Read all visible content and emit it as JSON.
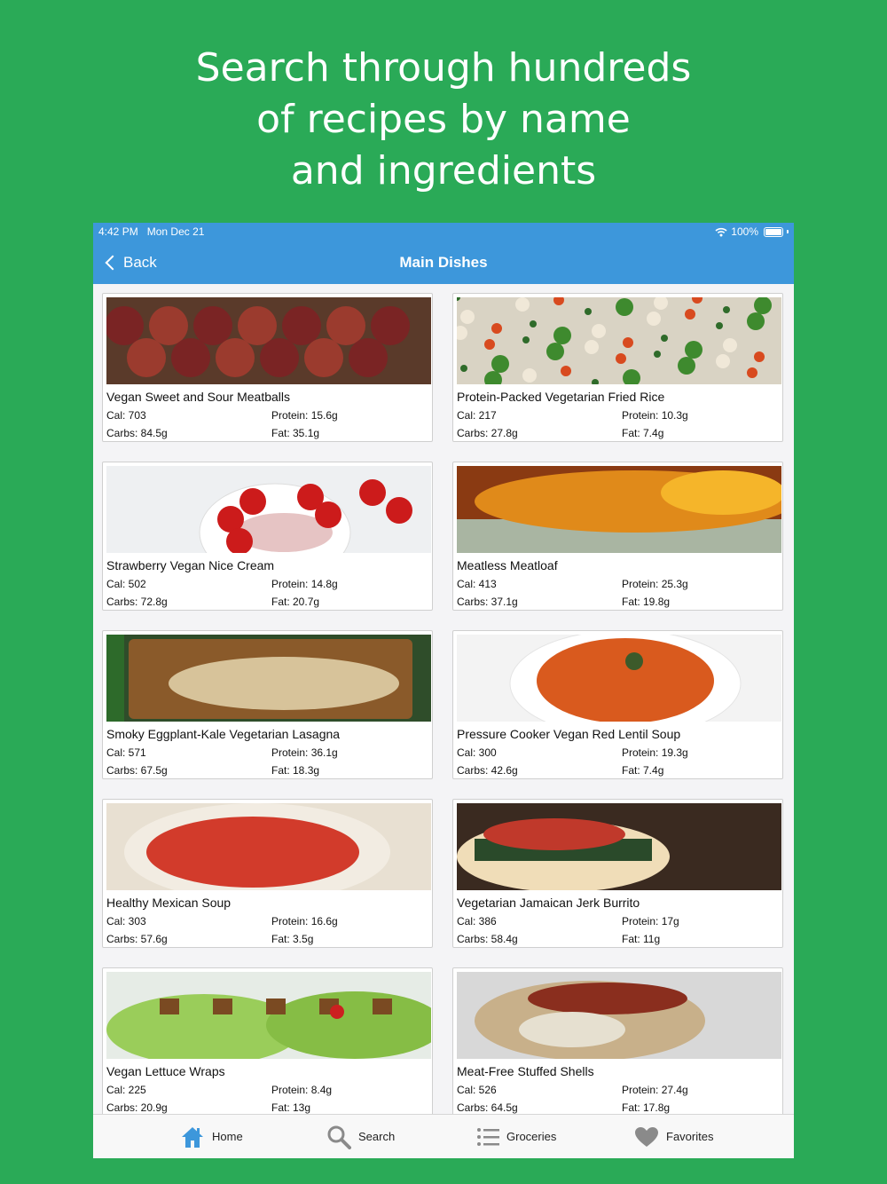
{
  "headline": {
    "lines": [
      "Search through hundreds",
      "of recipes by name",
      "and ingredients"
    ]
  },
  "status_bar": {
    "time": "4:42 PM",
    "date": "Mon Dec 21",
    "battery": "100%"
  },
  "nav": {
    "back_label": "Back",
    "title": "Main Dishes"
  },
  "recipes": [
    {
      "name": "Vegan Sweet and Sour Meatballs",
      "cal": "Cal: 703",
      "protein": "Protein: 15.6g",
      "carbs": "Carbs: 84.5g",
      "fat": "Fat: 35.1g",
      "image": "meatballs-photo"
    },
    {
      "name": "Protein-Packed Vegetarian Fried Rice",
      "cal": "Cal: 217",
      "protein": "Protein: 10.3g",
      "carbs": "Carbs: 27.8g",
      "fat": "Fat: 7.4g",
      "image": "fried-rice-photo"
    },
    {
      "name": "Strawberry Vegan Nice Cream",
      "cal": "Cal: 502",
      "protein": "Protein: 14.8g",
      "carbs": "Carbs: 72.8g",
      "fat": "Fat: 20.7g",
      "image": "nice-cream-photo"
    },
    {
      "name": "Meatless Meatloaf",
      "cal": "Cal: 413",
      "protein": "Protein: 25.3g",
      "carbs": "Carbs: 37.1g",
      "fat": "Fat: 19.8g",
      "image": "meatloaf-photo"
    },
    {
      "name": "Smoky Eggplant-Kale Vegetarian Lasagna",
      "cal": "Cal: 571",
      "protein": "Protein: 36.1g",
      "carbs": "Carbs: 67.5g",
      "fat": "Fat: 18.3g",
      "image": "lasagna-photo"
    },
    {
      "name": "Pressure Cooker Vegan Red Lentil Soup",
      "cal": "Cal: 300",
      "protein": "Protein: 19.3g",
      "carbs": "Carbs: 42.6g",
      "fat": "Fat: 7.4g",
      "image": "lentil-soup-photo"
    },
    {
      "name": "Healthy Mexican Soup",
      "cal": "Cal: 303",
      "protein": "Protein: 16.6g",
      "carbs": "Carbs: 57.6g",
      "fat": "Fat: 3.5g",
      "image": "mexican-soup-photo"
    },
    {
      "name": "Vegetarian Jamaican Jerk Burrito",
      "cal": "Cal: 386",
      "protein": "Protein: 17g",
      "carbs": "Carbs: 58.4g",
      "fat": "Fat: 11g",
      "image": "burrito-photo"
    },
    {
      "name": "Vegan Lettuce Wraps",
      "cal": "Cal: 225",
      "protein": "Protein: 8.4g",
      "carbs": "Carbs: 20.9g",
      "fat": "Fat: 13g",
      "image": "lettuce-wraps-photo"
    },
    {
      "name": "Meat-Free Stuffed Shells",
      "cal": "Cal: 526",
      "protein": "Protein: 27.4g",
      "carbs": "Carbs: 64.5g",
      "fat": "Fat: 17.8g",
      "image": "stuffed-shells-photo"
    }
  ],
  "tabs": [
    {
      "label": "Home",
      "icon": "home-icon"
    },
    {
      "label": "Search",
      "icon": "search-icon"
    },
    {
      "label": "Groceries",
      "icon": "list-icon"
    },
    {
      "label": "Favorites",
      "icon": "heart-icon"
    }
  ],
  "colors": {
    "background": "#2aaa57",
    "appbar": "#3d97db",
    "tab_active": "#3d97db",
    "tab_inactive": "#8a8a8a"
  }
}
